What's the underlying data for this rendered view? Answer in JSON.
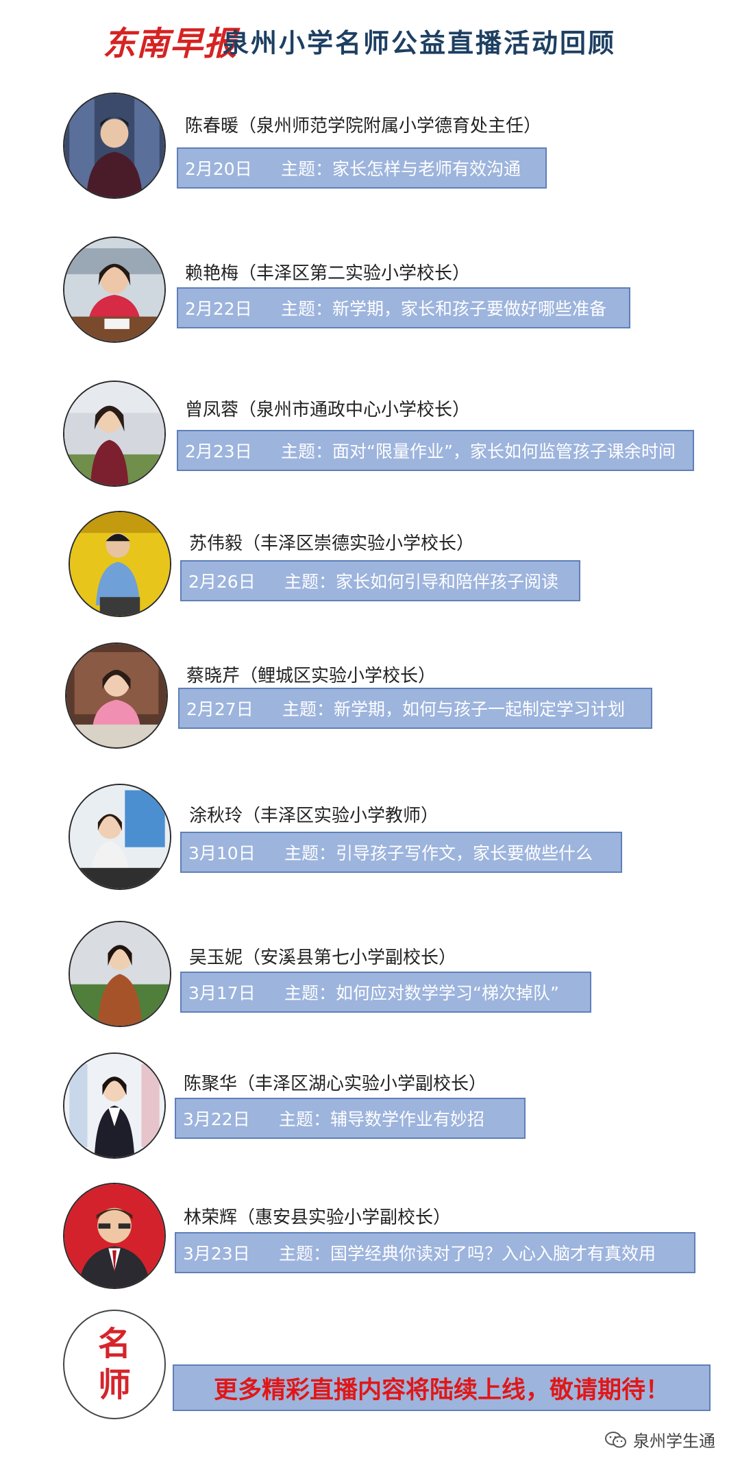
{
  "header": {
    "brand": "东南早报",
    "title": "泉州小学名师公益直播活动回顾"
  },
  "entries": [
    {
      "name": "陈春暖（泉州师范学院附属小学德育处主任）",
      "date": "2月20日",
      "topic": "主题：家长怎样与老师有效沟通"
    },
    {
      "name": "赖艳梅（丰泽区第二实验小学校长）",
      "date": "2月22日",
      "topic": "主题：新学期，家长和孩子要做好哪些准备"
    },
    {
      "name": "曾凤蓉（泉州市通政中心小学校长）",
      "date": "2月23日",
      "topic": "主题：面对“限量作业”，家长如何监管孩子课余时间"
    },
    {
      "name": "苏伟毅（丰泽区崇德实验小学校长）",
      "date": "2月26日",
      "topic": "主题：家长如何引导和陪伴孩子阅读"
    },
    {
      "name": "蔡晓芹（鲤城区实验小学校长）",
      "date": "2月27日",
      "topic": "主题：新学期，如何与孩子一起制定学习计划"
    },
    {
      "name": "涂秋玲（丰泽区实验小学教师）",
      "date": "3月10日",
      "topic": "主题：引导孩子写作文，家长要做些什么"
    },
    {
      "name": "吴玉妮（安溪县第七小学副校长）",
      "date": "3月17日",
      "topic": "主题：如何应对数学学习“梯次掉队”"
    },
    {
      "name": "陈聚华（丰泽区湖心实验小学副校长）",
      "date": "3月22日",
      "topic": "主题：辅导数学作业有妙招"
    },
    {
      "name": "林荣辉（惠安县实验小学副校长）",
      "date": "3月23日",
      "topic": "主题：国学经典你读对了吗？入心入脑才有真效用"
    }
  ],
  "badge": {
    "line1": "名",
    "line2": "师"
  },
  "footer": {
    "cta": "更多精彩直播内容将陆续上线，敬请期待！",
    "watermark": "泉州学生通",
    "watermark_icon": "wechat-icon"
  },
  "colors": {
    "brand_red": "#d52323",
    "title_navy": "#1d3f62",
    "box_fill": "#9db4dd",
    "box_border": "#5f7fb8",
    "cta_text": "#e01717"
  }
}
